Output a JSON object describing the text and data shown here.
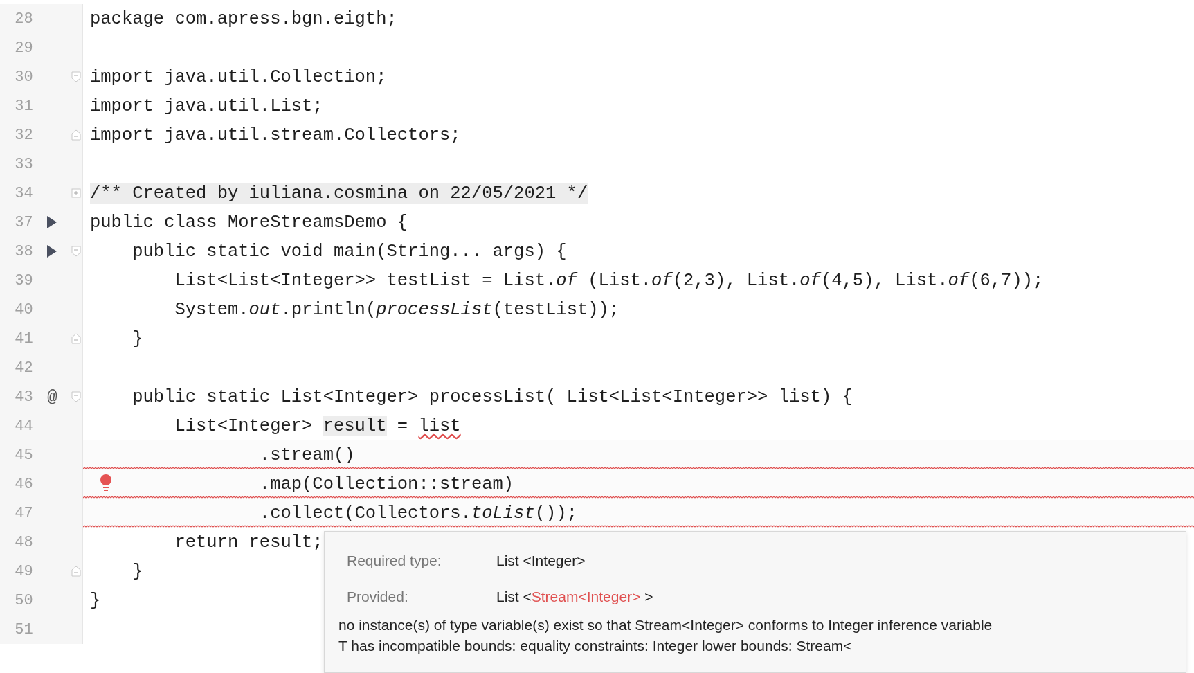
{
  "lines": [
    {
      "number": "28",
      "error": false,
      "code": [
        {
          "text": "package com.apress.bgn.eigth;"
        }
      ]
    },
    {
      "number": "29",
      "error": false
    },
    {
      "number": "30",
      "error": false,
      "gutter": [
        {
          "kind": "fold-open"
        }
      ],
      "code": [
        {
          "text": "import java.util.Collection;"
        }
      ]
    },
    {
      "number": "31",
      "error": false,
      "code": [
        {
          "text": "import java.util.List;"
        }
      ]
    },
    {
      "number": "32",
      "error": false,
      "gutter": [
        {
          "kind": "fold-close"
        }
      ],
      "code": [
        {
          "text": "import java.util.stream.Collectors;"
        }
      ]
    },
    {
      "number": "33",
      "error": false
    },
    {
      "number": "34",
      "error": false,
      "gutter": [
        {
          "kind": "fold-collapsed"
        }
      ],
      "code": [
        {
          "text": "/** Created by iuliana.cosmina on 22/05/2021 */",
          "kind": "shaded"
        }
      ]
    },
    {
      "number": "37",
      "error": false,
      "gutter": [
        {
          "kind": "run"
        }
      ],
      "code": [
        {
          "text": "public class MoreStreamsDemo {"
        }
      ]
    },
    {
      "number": "38",
      "error": false,
      "gutter": [
        {
          "kind": "run"
        },
        {
          "kind": "fold-open"
        }
      ],
      "code": [
        {
          "text": "    public static void main(String... args) {"
        }
      ]
    },
    {
      "number": "39",
      "error": false,
      "code": [
        {
          "text": "        List<List<Integer>> testList = List."
        },
        {
          "text": "of",
          "kind": "italic"
        },
        {
          "text": " (List."
        },
        {
          "text": "of",
          "kind": "italic"
        },
        {
          "text": "(2,3), List."
        },
        {
          "text": "of",
          "kind": "italic"
        },
        {
          "text": "(4,5), List."
        },
        {
          "text": "of",
          "kind": "italic"
        },
        {
          "text": "(6,7));"
        }
      ]
    },
    {
      "number": "40",
      "error": false,
      "code": [
        {
          "text": "        System."
        },
        {
          "text": "out",
          "kind": "italic"
        },
        {
          "text": ".println("
        },
        {
          "text": "processList",
          "kind": "italic"
        },
        {
          "text": "(testList));"
        }
      ]
    },
    {
      "number": "41",
      "error": false,
      "gutter": [
        {
          "kind": "fold-close"
        }
      ],
      "code": [
        {
          "text": "    }"
        }
      ]
    },
    {
      "number": "42",
      "error": false
    },
    {
      "number": "43",
      "error": false,
      "gutter": [
        {
          "kind": "override",
          "text": "@"
        },
        {
          "kind": "fold-open"
        }
      ],
      "code": [
        {
          "text": "    public static List<Integer> processList( List<List<Integer>> list) {"
        }
      ]
    },
    {
      "number": "44",
      "error": false,
      "code": [
        {
          "text": "        List<Integer> "
        },
        {
          "text": "result",
          "kind": "shaded"
        },
        {
          "text": " = "
        },
        {
          "text": "list",
          "kind": "squiggle"
        }
      ]
    },
    {
      "number": "45",
      "error": true,
      "code": [
        {
          "text": "                .stream()"
        }
      ]
    },
    {
      "number": "46",
      "error": true,
      "gutter": [
        {
          "kind": "bulb"
        }
      ],
      "code": [
        {
          "text": "                .map(Collection::stream)"
        }
      ]
    },
    {
      "number": "47",
      "error": true,
      "code": [
        {
          "text": "                .collect(Collectors."
        },
        {
          "text": "toList",
          "kind": "italic"
        },
        {
          "text": "());"
        }
      ]
    },
    {
      "number": "48",
      "error": false,
      "code": [
        {
          "text": "        return result;"
        }
      ]
    },
    {
      "number": "49",
      "error": false,
      "gutter": [
        {
          "kind": "fold-close"
        }
      ],
      "code": [
        {
          "text": "    }"
        }
      ]
    },
    {
      "number": "50",
      "error": false,
      "code": [
        {
          "text": "}"
        }
      ]
    },
    {
      "number": "51",
      "error": false
    }
  ],
  "tooltip": {
    "required_label": "Required type:",
    "required_value": "List  <Integer>",
    "provided_label": "Provided:",
    "provided_prefix": "List  <",
    "provided_type": "Stream<Integer>",
    "provided_suffix": " >",
    "message": [
      "no instance(s) of type variable(s) exist so that Stream<Integer> conforms to Integer inference variable",
      "T has incompatible bounds: equality constraints: Integer lower bounds: Stream<"
    ]
  }
}
